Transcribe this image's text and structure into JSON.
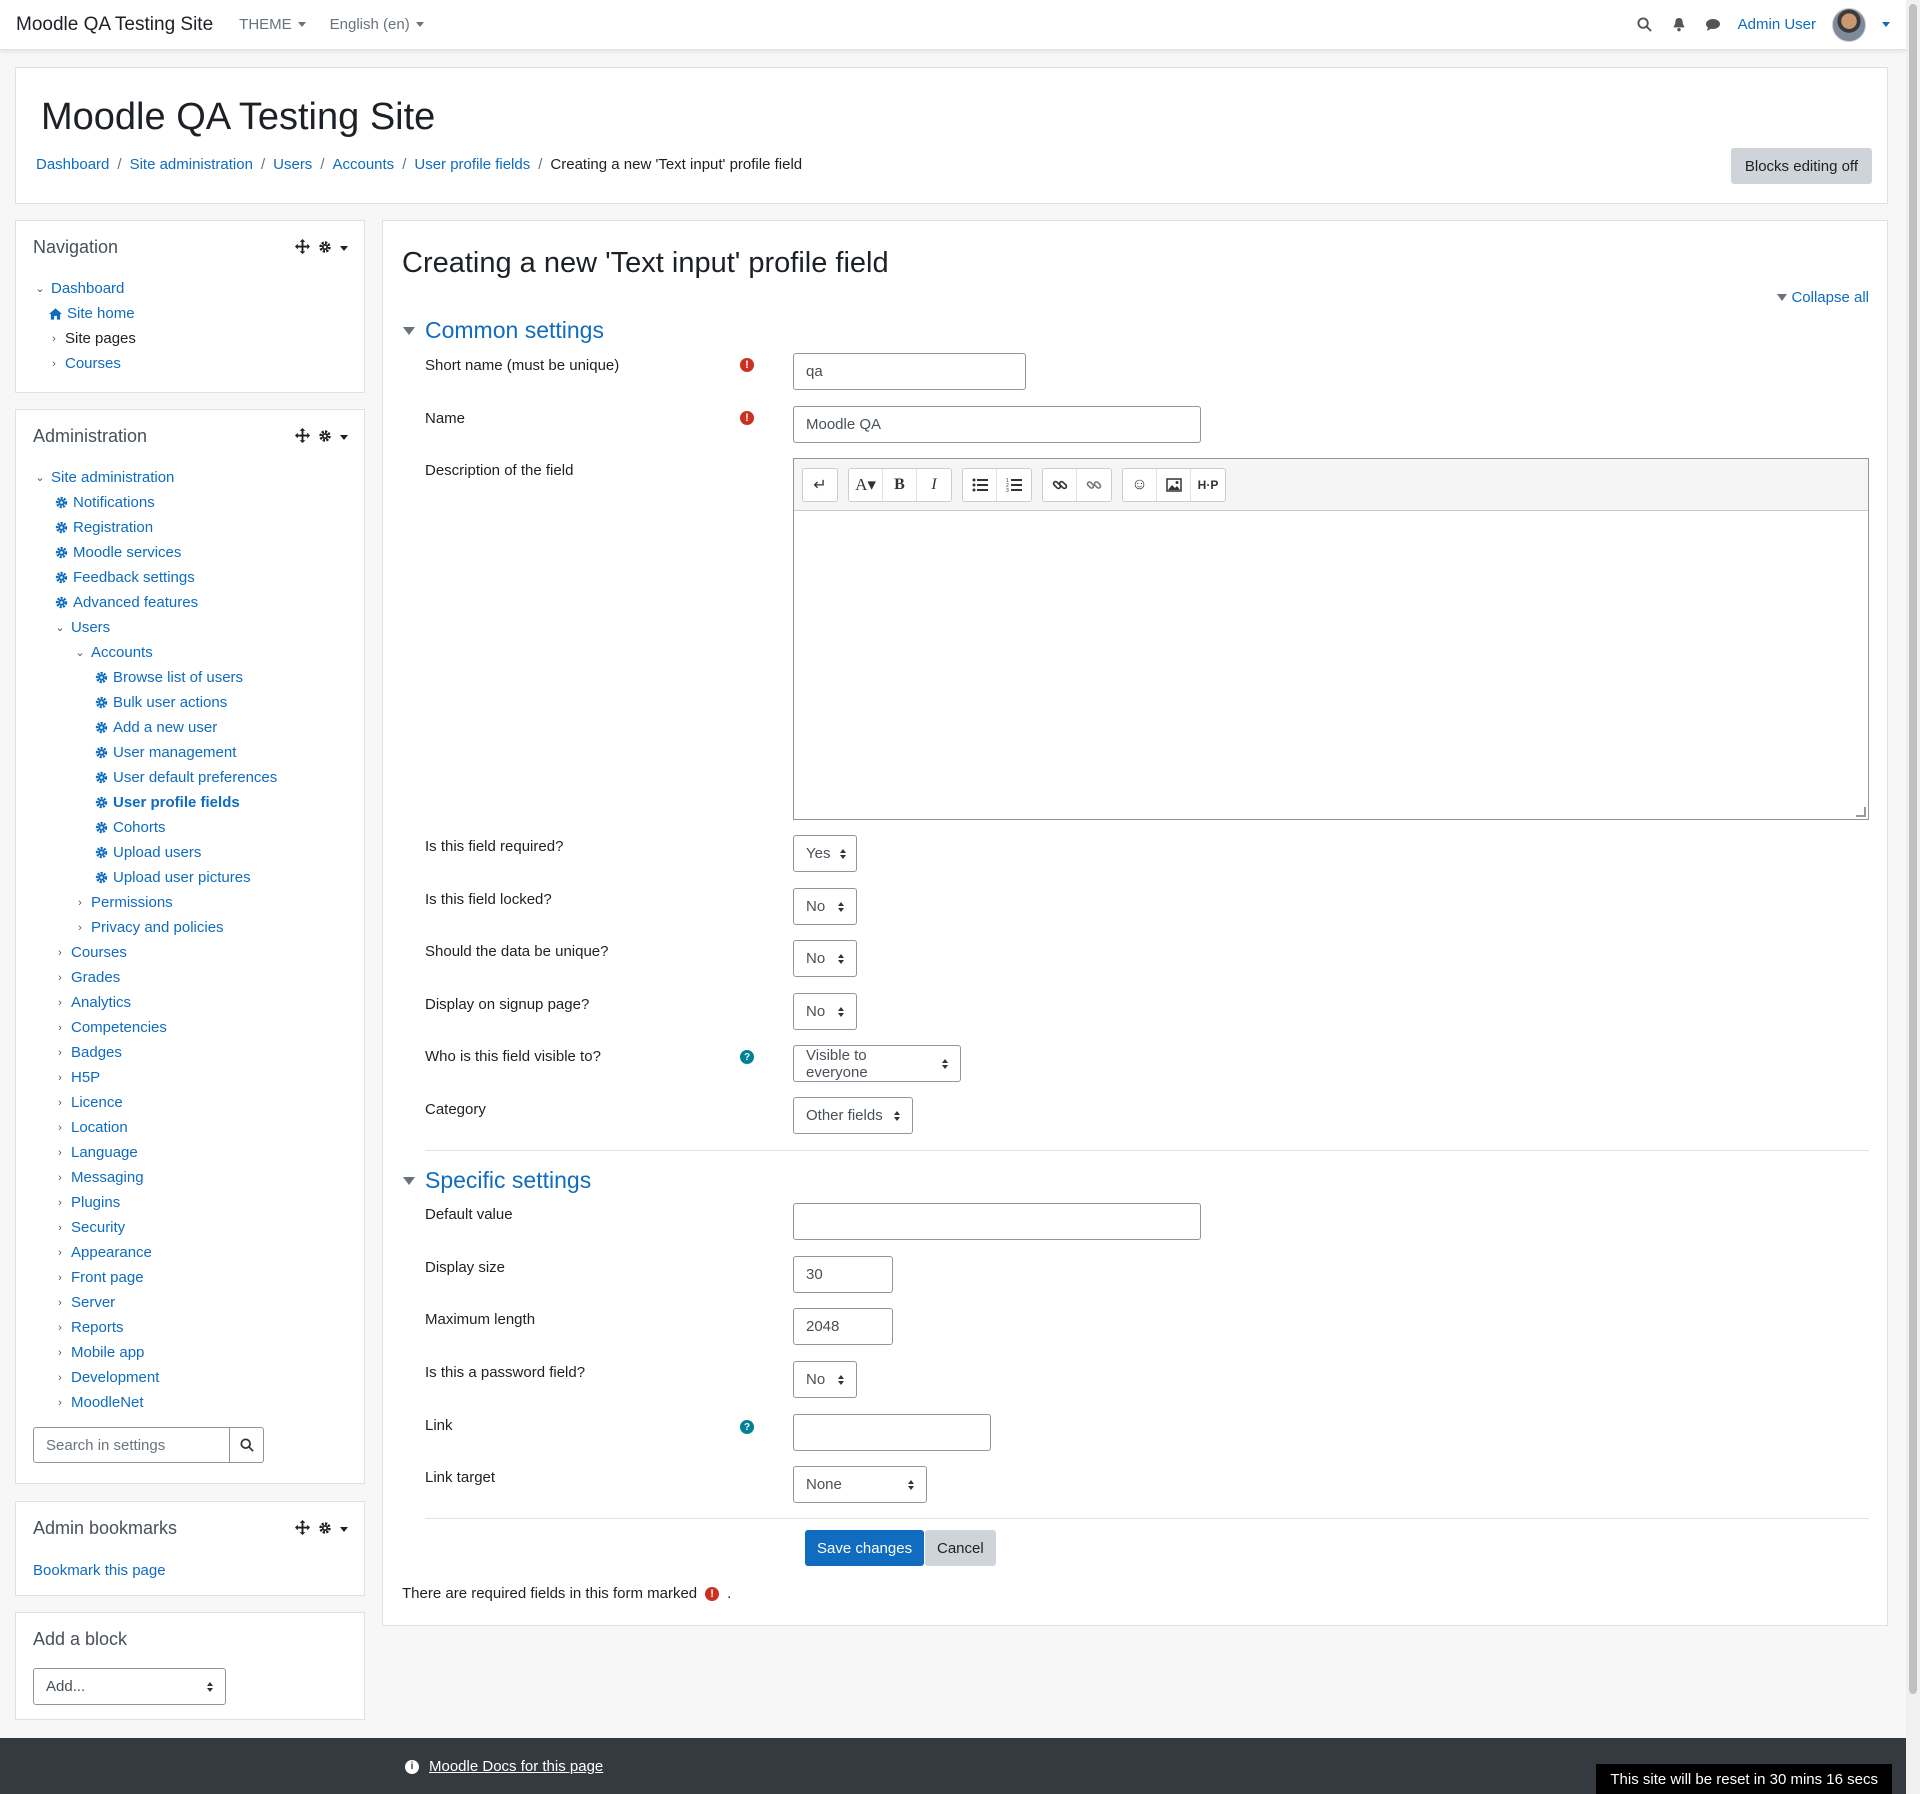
{
  "navbar": {
    "brand": "Moodle QA Testing Site",
    "theme_label": "THEME",
    "language_label": "English (en)",
    "user_name": "Admin User"
  },
  "header": {
    "title": "Moodle QA Testing Site",
    "breadcrumb": [
      "Dashboard",
      "Site administration",
      "Users",
      "Accounts",
      "User profile fields",
      "Creating a new 'Text input' profile field"
    ],
    "blocks_editing_label": "Blocks editing off"
  },
  "navigation_block": {
    "title": "Navigation",
    "items": [
      "Dashboard",
      "Site home",
      "Site pages",
      "Courses"
    ]
  },
  "admin_block": {
    "title": "Administration",
    "items": [
      "Site administration",
      "Notifications",
      "Registration",
      "Moodle services",
      "Feedback settings",
      "Advanced features",
      "Users",
      "Accounts",
      "Browse list of users",
      "Bulk user actions",
      "Add a new user",
      "User management",
      "User default preferences",
      "User profile fields",
      "Cohorts",
      "Upload users",
      "Upload user pictures",
      "Permissions",
      "Privacy and policies",
      "Courses",
      "Grades",
      "Analytics",
      "Competencies",
      "Badges",
      "H5P",
      "Licence",
      "Location",
      "Language",
      "Messaging",
      "Plugins",
      "Security",
      "Appearance",
      "Front page",
      "Server",
      "Reports",
      "Mobile app",
      "Development",
      "MoodleNet"
    ],
    "search_placeholder": "Search in settings"
  },
  "bookmarks_block": {
    "title": "Admin bookmarks",
    "link": "Bookmark this page"
  },
  "add_block": {
    "title": "Add a block",
    "select_value": "Add..."
  },
  "main": {
    "heading": "Creating a new 'Text input' profile field",
    "collapse_all": "Collapse all",
    "common_settings": {
      "title": "Common settings",
      "short_name_label": "Short name (must be unique)",
      "short_name_value": "qa",
      "name_label": "Name",
      "name_value": "Moodle QA",
      "description_label": "Description of the field",
      "required_label": "Is this field required?",
      "required_value": "Yes",
      "locked_label": "Is this field locked?",
      "locked_value": "No",
      "unique_label": "Should the data be unique?",
      "unique_value": "No",
      "signup_label": "Display on signup page?",
      "signup_value": "No",
      "visible_label": "Who is this field visible to?",
      "visible_value": "Visible to everyone",
      "category_label": "Category",
      "category_value": "Other fields"
    },
    "specific_settings": {
      "title": "Specific settings",
      "default_label": "Default value",
      "default_value": "",
      "display_size_label": "Display size",
      "display_size_value": "30",
      "max_length_label": "Maximum length",
      "max_length_value": "2048",
      "password_label": "Is this a password field?",
      "password_value": "No",
      "link_label": "Link",
      "link_value": "",
      "link_target_label": "Link target",
      "link_target_value": "None"
    },
    "save_label": "Save changes",
    "cancel_label": "Cancel",
    "required_note": "There are required fields in this form marked",
    "required_note_end": "."
  },
  "footer": {
    "docs_link": "Moodle Docs for this page",
    "reset_notice": "This site will be reset in 30 mins 16 secs"
  },
  "colors": {
    "link": "#0f6cbf",
    "required": "#ca3120",
    "help": "#008196",
    "footer": "#343a40"
  }
}
